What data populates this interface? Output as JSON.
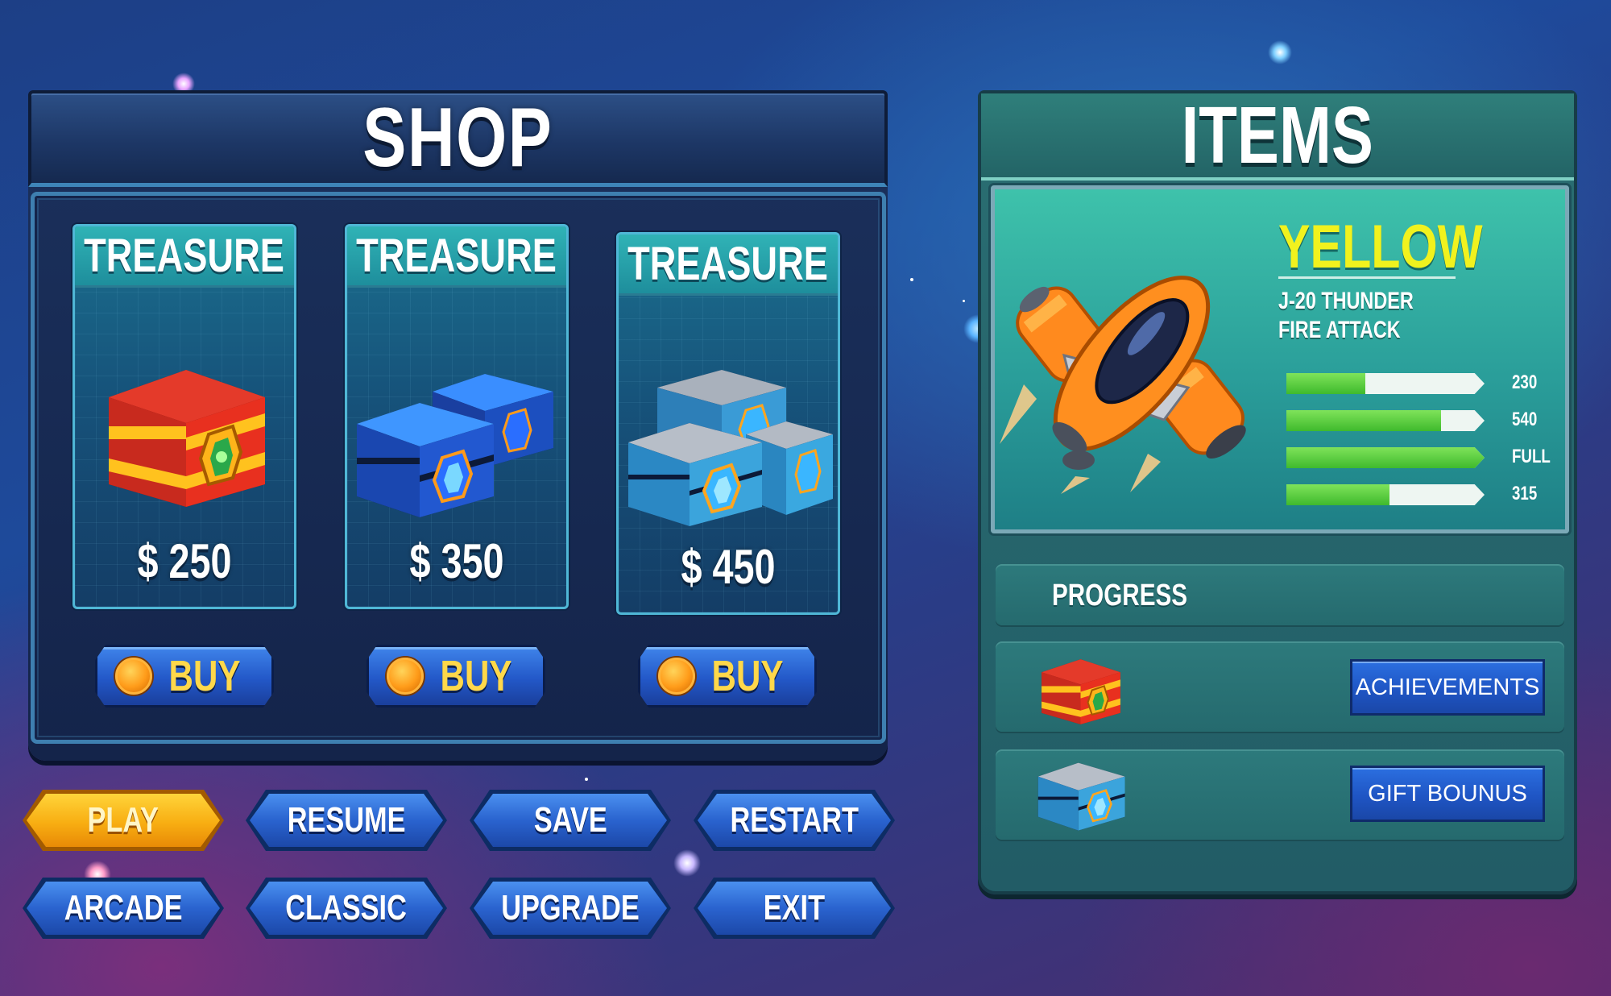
{
  "shop": {
    "title": "SHOP",
    "items": [
      {
        "title": "TREASURE",
        "price": "$ 250",
        "buy_label": "BUY",
        "chest": "red-gold-chest-icon"
      },
      {
        "title": "TREASURE",
        "price": "$ 350",
        "buy_label": "BUY",
        "chest": "blue-chests-icon"
      },
      {
        "title": "TREASURE",
        "price": "$ 450",
        "buy_label": "BUY",
        "chest": "silver-chests-icon"
      }
    ]
  },
  "menu": {
    "buttons": [
      "PLAY",
      "RESUME",
      "SAVE",
      "RESTART",
      "ARCADE",
      "CLASSIC",
      "UPGRADE",
      "EXIT"
    ],
    "active": "PLAY"
  },
  "items": {
    "title": "ITEMS",
    "ship": {
      "name": "YELLOW",
      "subtitle_1": "J-20 THUNDER",
      "subtitle_2": "FIRE ATTACK",
      "stats": [
        {
          "value": "230",
          "fill": 0.4
        },
        {
          "value": "540",
          "fill": 0.78
        },
        {
          "value": "FULL",
          "fill": 1.0
        },
        {
          "value": "315",
          "fill": 0.52
        }
      ]
    },
    "progress_label": "PROGRESS",
    "achievements_label": "ACHIEVEMENTS",
    "gift_bonus_label": "GIFT BOUNUS"
  },
  "colors": {
    "accent_yellow": "#f1f21e",
    "button_blue": "#2a63cf",
    "active_orange": "#f8ae12",
    "stat_green": "#3fba2d"
  }
}
